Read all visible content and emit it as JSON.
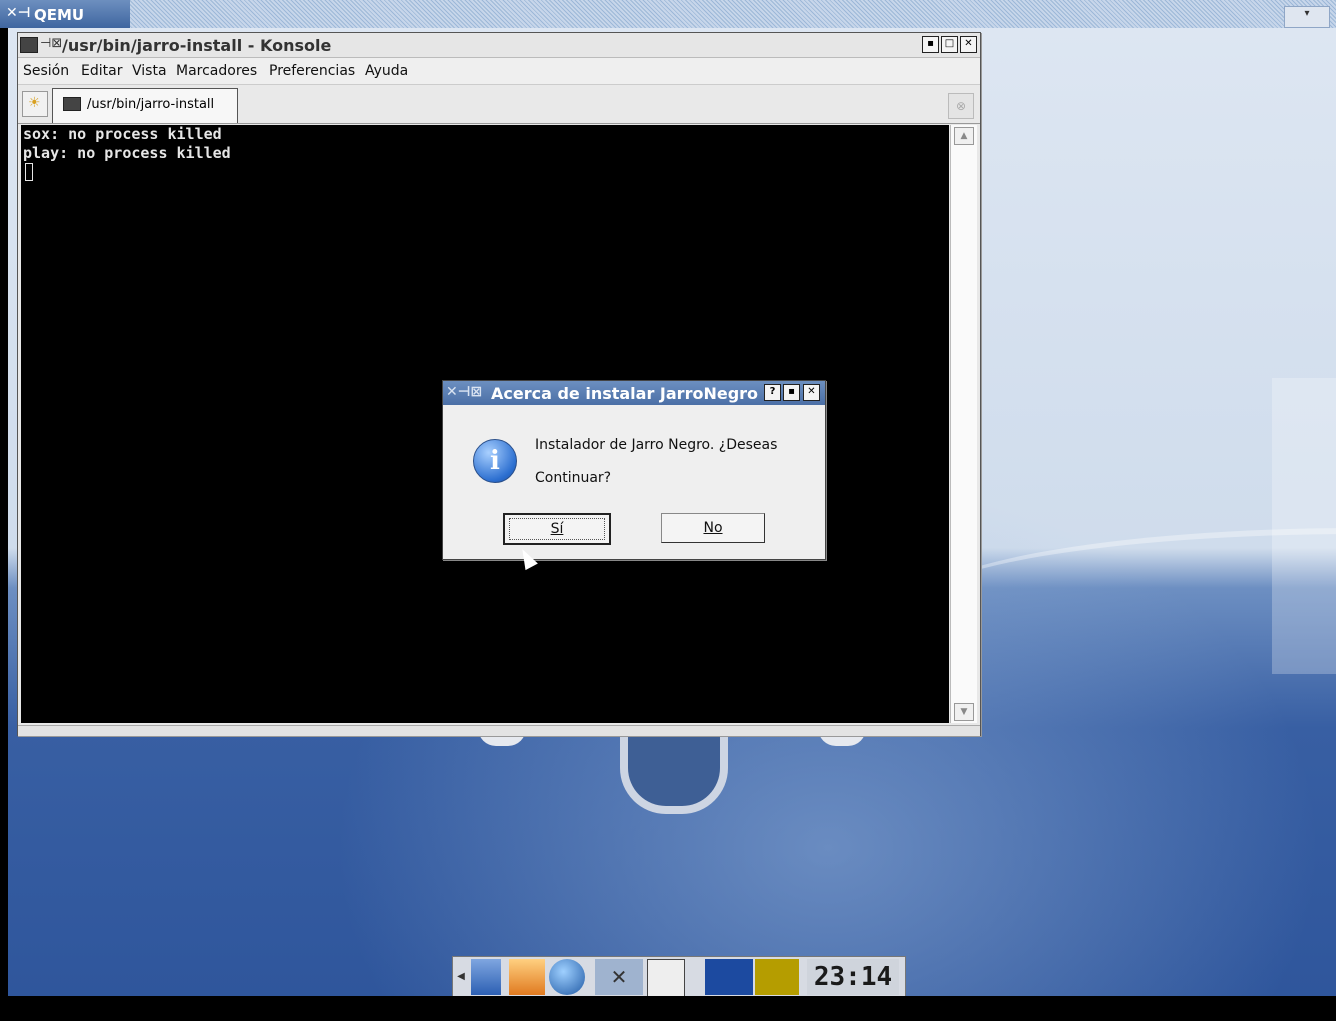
{
  "qemu": {
    "title": "QEMU",
    "icon": "x11-icon",
    "menu_button": "▾"
  },
  "konsole": {
    "title": "/usr/bin/jarro-install - Konsole",
    "buttons": {
      "minimize": "▪",
      "maximize": "□",
      "close": "✕"
    },
    "menu": [
      "Sesión",
      "Editar",
      "Vista",
      "Marcadores",
      "Preferencias",
      "Ayuda"
    ],
    "tab_label": "/usr/bin/jarro-install",
    "terminal_lines": [
      "sox: no process killed",
      "play: no process killed"
    ]
  },
  "dialog": {
    "title": "Acerca de instalar JarroNegro",
    "buttons": {
      "help": "?",
      "minimize": "▪",
      "close": "✕"
    },
    "message_line1": "Instalador de Jarro Negro. ¿Deseas",
    "message_line2": "Continuar?",
    "yes_button": "Sí",
    "no_button": "No",
    "icon": "information-icon"
  },
  "taskbar": {
    "clock": "23:14"
  },
  "colors": {
    "dialog_title": "#4b6fa6",
    "terminal_bg": "#000000",
    "desktop_blue": "#2f569c"
  }
}
